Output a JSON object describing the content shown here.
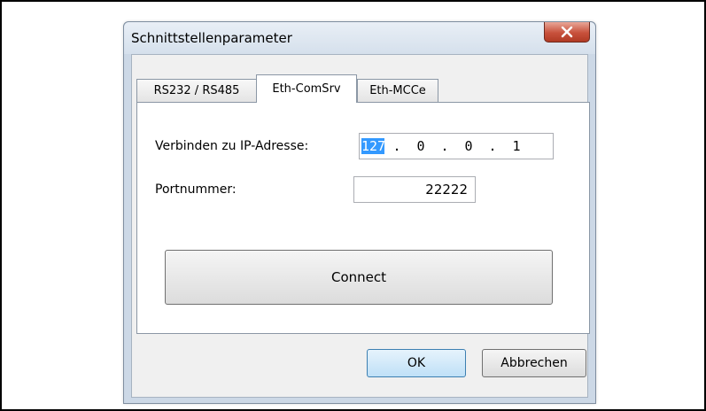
{
  "window": {
    "title": "Schnittstellenparameter",
    "close_glyph": "X"
  },
  "tabs": [
    {
      "label": "RS232 / RS485",
      "active": false
    },
    {
      "label": "Eth-ComSrv",
      "active": true
    },
    {
      "label": "Eth-MCCe",
      "active": false
    }
  ],
  "form": {
    "ip_label": "Verbinden zu IP-Adresse:",
    "ip_octets": [
      "127",
      "0",
      "0",
      "1"
    ],
    "ip_separator": ".",
    "port_label": "Portnummer:",
    "port_value": "22222",
    "connect_label": "Connect"
  },
  "footer": {
    "ok_label": "OK",
    "cancel_label": "Abbrechen"
  },
  "colors": {
    "selection": "#3399ff",
    "close_button": "#c8513c"
  }
}
